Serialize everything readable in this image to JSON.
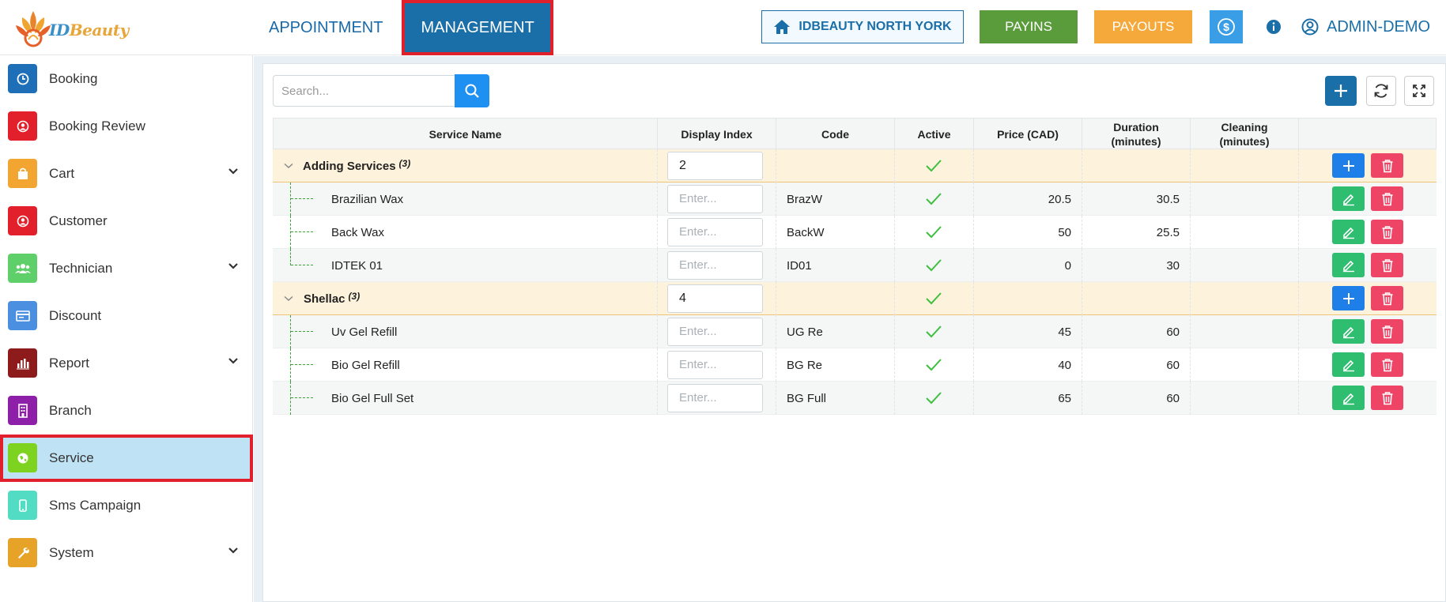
{
  "app": {
    "logo_text_a": "ID",
    "logo_text_b": "Beauty"
  },
  "topnav": {
    "tabs": [
      {
        "label": "APPOINTMENT",
        "active": false
      },
      {
        "label": "MANAGEMENT",
        "active": true
      }
    ]
  },
  "toolbar": {
    "branch_label": "IDBEAUTY NORTH YORK",
    "payins_label": "PAYINS",
    "payouts_label": "PAYOUTS",
    "user_label": "ADMIN-DEMO"
  },
  "sidebar": {
    "items": [
      {
        "label": "Booking",
        "icon": "clock-icon",
        "color": "#1e6fb8",
        "expandable": false,
        "active": false
      },
      {
        "label": "Booking Review",
        "icon": "user-circle-icon",
        "color": "#e2202b",
        "expandable": false,
        "active": false
      },
      {
        "label": "Cart",
        "icon": "shopping-bag-icon",
        "color": "#f3a531",
        "expandable": true,
        "active": false
      },
      {
        "label": "Customer",
        "icon": "user-circle-icon",
        "color": "#e2202b",
        "expandable": false,
        "active": false
      },
      {
        "label": "Technician",
        "icon": "group-icon",
        "color": "#5fcf6a",
        "expandable": true,
        "active": false
      },
      {
        "label": "Discount",
        "icon": "card-icon",
        "color": "#4a8fe0",
        "expandable": false,
        "active": false
      },
      {
        "label": "Report",
        "icon": "bar-chart-icon",
        "color": "#8e1b1b",
        "expandable": true,
        "active": false
      },
      {
        "label": "Branch",
        "icon": "building-icon",
        "color": "#8d1fa8",
        "expandable": false,
        "active": false
      },
      {
        "label": "Service",
        "icon": "globe-icon",
        "color": "#7ed321",
        "expandable": false,
        "active": true
      },
      {
        "label": "Sms Campaign",
        "icon": "mobile-icon",
        "color": "#52dcc4",
        "expandable": false,
        "active": false
      },
      {
        "label": "System",
        "icon": "wrench-icon",
        "color": "#e7a327",
        "expandable": true,
        "active": false
      }
    ]
  },
  "search": {
    "placeholder": "Search..."
  },
  "table": {
    "columns": [
      "Service Name",
      "Display Index",
      "Code",
      "Active",
      "Price (CAD)",
      "Duration\n(minutes)",
      "Cleaning\n(minutes)",
      ""
    ],
    "index_placeholder": "Enter...",
    "groups": [
      {
        "name": "Adding Services",
        "count": "(3)",
        "display_index": "2",
        "active": true,
        "services": [
          {
            "name": "Brazilian Wax",
            "code": "BrazW",
            "active": true,
            "price": "20.5",
            "duration": "30.5",
            "cleaning": ""
          },
          {
            "name": "Back Wax",
            "code": "BackW",
            "active": true,
            "price": "50",
            "duration": "25.5",
            "cleaning": ""
          },
          {
            "name": "IDTEK 01",
            "code": "ID01",
            "active": true,
            "price": "0",
            "duration": "30",
            "cleaning": ""
          }
        ]
      },
      {
        "name": "Shellac",
        "count": "(3)",
        "display_index": "4",
        "active": true,
        "services": [
          {
            "name": "Uv Gel Refill",
            "code": "UG Re",
            "active": true,
            "price": "45",
            "duration": "60",
            "cleaning": ""
          },
          {
            "name": "Bio Gel Refill",
            "code": "BG Re",
            "active": true,
            "price": "40",
            "duration": "60",
            "cleaning": ""
          },
          {
            "name": "Bio Gel Full Set",
            "code": "BG Full",
            "active": true,
            "price": "65",
            "duration": "60",
            "cleaning": ""
          }
        ]
      }
    ]
  }
}
